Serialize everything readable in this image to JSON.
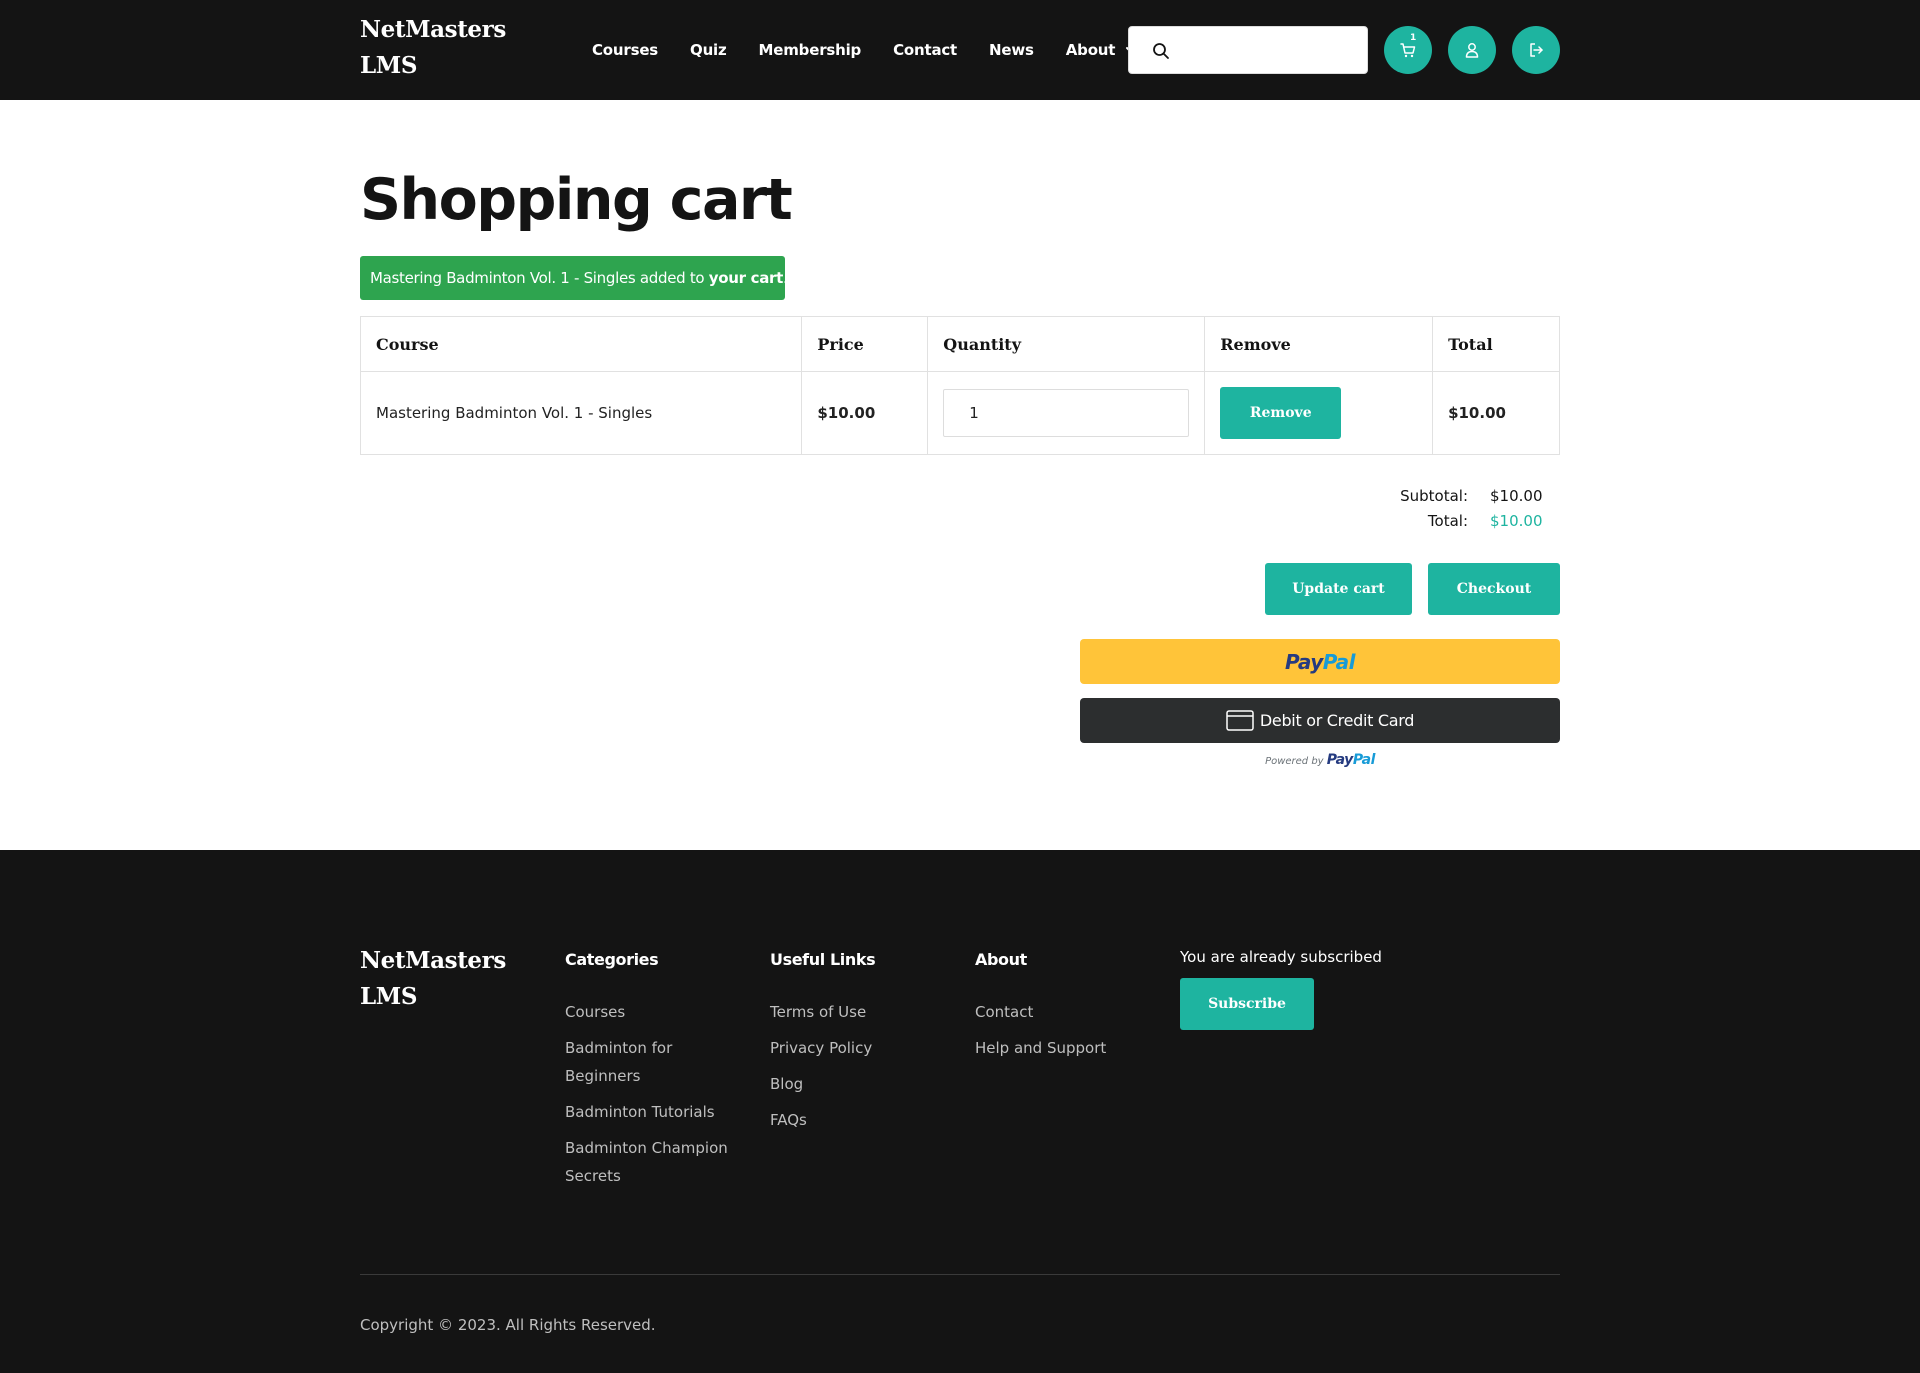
{
  "header": {
    "brand_line1": "NetMasters",
    "brand_line2": "LMS",
    "nav": [
      "Courses",
      "Quiz",
      "Membership",
      "Contact",
      "News",
      "About"
    ],
    "search_placeholder": "",
    "cart_count": "1"
  },
  "main": {
    "title": "Shopping cart",
    "alert": {
      "text": "Mastering Badminton Vol. 1 - Singles added to ",
      "bold": "your cart",
      "end": "."
    },
    "table": {
      "headers": [
        "Course",
        "Price",
        "Quantity",
        "Remove",
        "Total"
      ],
      "rows": [
        {
          "course": "Mastering Badminton Vol. 1 - Singles",
          "price": "$10.00",
          "quantity": "1",
          "remove_label": "Remove",
          "total": "$10.00"
        }
      ]
    },
    "totals": {
      "subtotal_label": "Subtotal:",
      "subtotal": "$10.00",
      "total_label": "Total:",
      "total": "$10.00"
    },
    "update_label": "Update cart",
    "checkout_label": "Checkout",
    "paypal": {
      "logo_a": "Pay",
      "logo_b": "Pal",
      "card_label": "Debit or Credit Card",
      "powered_by": "Powered by"
    }
  },
  "footer": {
    "brand_line1": "NetMasters",
    "brand_line2": "LMS",
    "columns": [
      {
        "heading": "Categories",
        "links": [
          "Courses",
          "Badminton for Beginners",
          "Badminton Tutorials",
          "Badminton Champion Secrets"
        ]
      },
      {
        "heading": "Useful Links",
        "links": [
          "Terms of Use",
          "Privacy Policy",
          "Blog",
          "FAQs"
        ]
      },
      {
        "heading": "About",
        "links": [
          "Contact",
          "Help and Support"
        ]
      }
    ],
    "subscribe_text": "You are already subscribed",
    "subscribe_label": "Subscribe",
    "copyright": "Copyright © 2023. All Rights Reserved."
  },
  "colors": {
    "accent": "#1eb4a0",
    "header_bg": "#141414",
    "alert_bg": "#2ea44f",
    "paypal_yellow": "#ffc439",
    "card_button": "#2c2e2f"
  },
  "icons": [
    "search-icon",
    "cart-icon",
    "user-icon",
    "logout-icon",
    "chevron-down-icon",
    "credit-card-icon"
  ]
}
